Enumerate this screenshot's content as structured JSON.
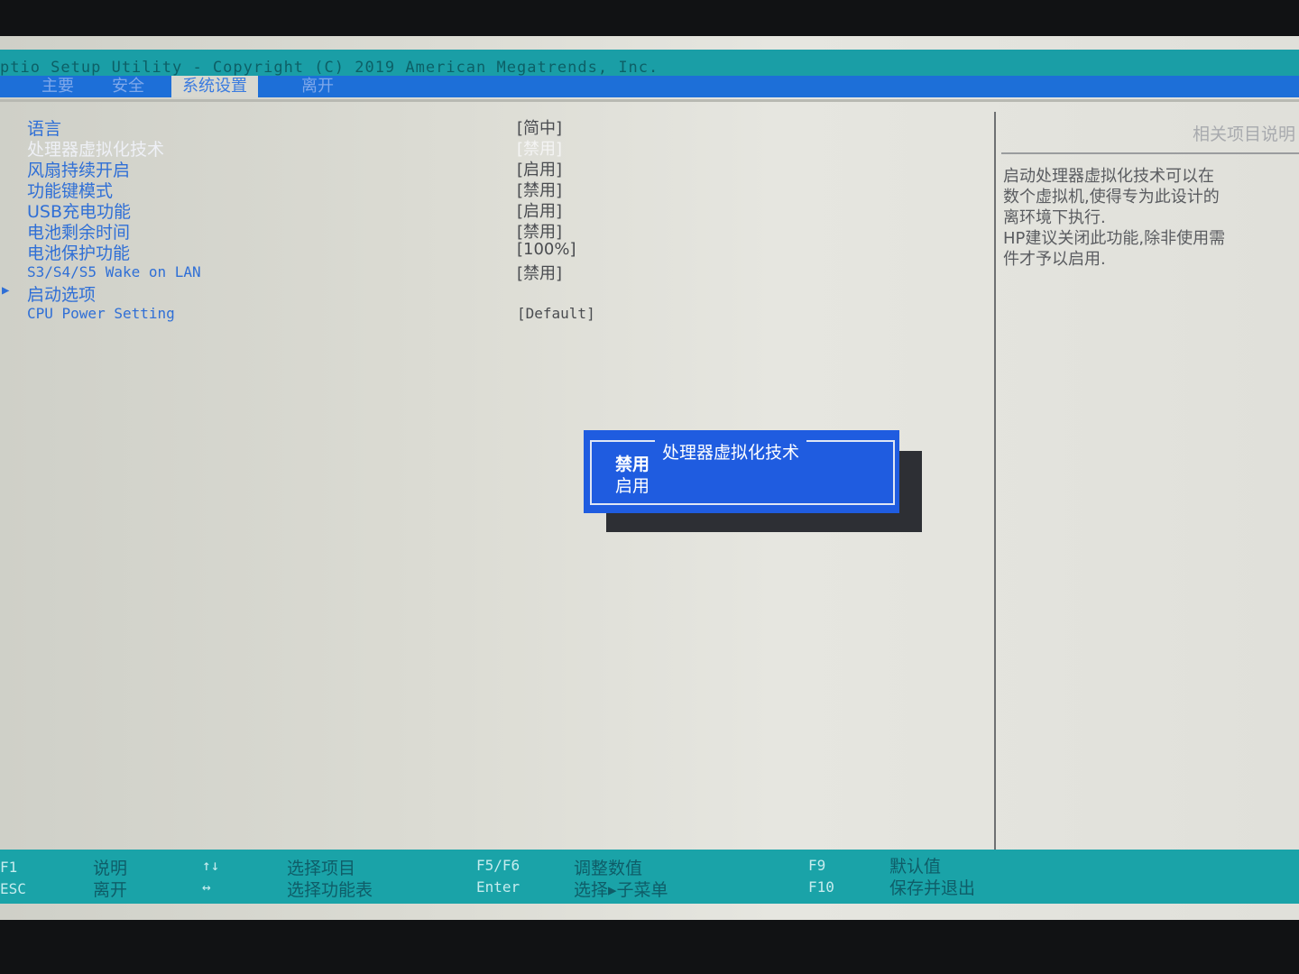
{
  "window": {
    "title": "ptio Setup Utility - Copyright (C) 2019 American Megatrends, Inc."
  },
  "tabs": [
    {
      "label": "主要"
    },
    {
      "label": "安全"
    },
    {
      "label": "系统设置"
    },
    {
      "label": "离开"
    }
  ],
  "active_tab": "系统设置",
  "settings": [
    {
      "label": "语言",
      "value": "[简中]"
    },
    {
      "label": "处理器虚拟化技术",
      "value": "[禁用]"
    },
    {
      "label": "风扇持续开启",
      "value": "[启用]"
    },
    {
      "label": "功能键模式",
      "value": "[禁用]"
    },
    {
      "label": "USB充电功能",
      "value": "[启用]"
    },
    {
      "label": "电池剩余时间",
      "value": "[禁用]"
    },
    {
      "label": "电池保护功能",
      "value": "[100%]"
    },
    {
      "label": "S3/S4/S5 Wake on LAN",
      "value": "[禁用]"
    },
    {
      "label": "启动选项",
      "value": ""
    },
    {
      "label": "CPU Power Setting",
      "value": "[Default]"
    }
  ],
  "help": {
    "title": "相关项目说明",
    "lines": [
      "启动处理器虚拟化技术可以在",
      "数个虚拟机,使得专为此设计的",
      "离环境下执行.",
      "HP建议关闭此功能,除非使用需",
      "件才予以启用."
    ]
  },
  "popup": {
    "title": "处理器虚拟化技术",
    "options": [
      "禁用",
      "启用"
    ],
    "selected": "禁用"
  },
  "footer": {
    "keys": [
      {
        "key": "F1",
        "desc": "说明"
      },
      {
        "key": "ESC",
        "desc": "离开"
      },
      {
        "key": "↑↓",
        "desc": "选择项目"
      },
      {
        "key": "↔",
        "desc": "选择功能表"
      },
      {
        "key": "F5/F6",
        "desc": "调整数值"
      },
      {
        "key": "Enter",
        "desc": "选择▸子菜单"
      },
      {
        "key": "F9",
        "desc": "默认值"
      },
      {
        "key": "F10",
        "desc": "保存并退出"
      }
    ]
  },
  "colors": {
    "accent_teal": "#1aa3a8",
    "menu_blue": "#1d6fd8",
    "popup_blue": "#1f5ce0",
    "label_blue": "#2f6fd6"
  }
}
